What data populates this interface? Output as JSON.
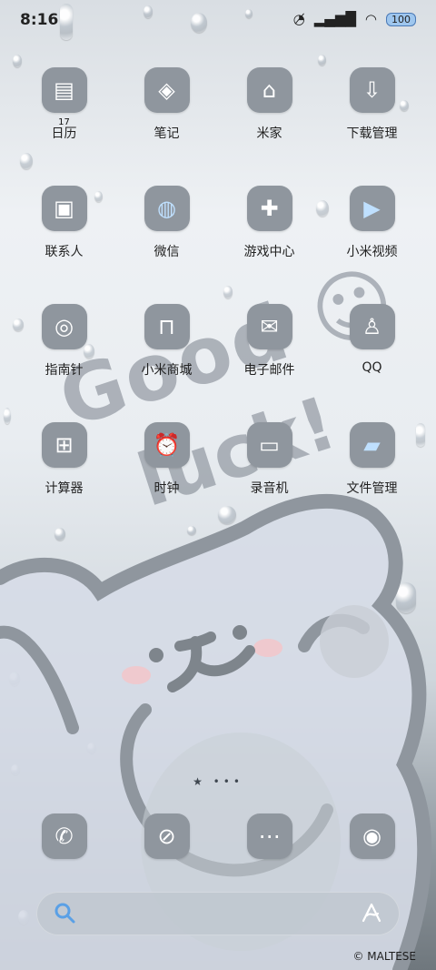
{
  "status_bar": {
    "time": "8:16",
    "battery": "100",
    "icons": [
      "do-not-disturb-icon",
      "signal-icon",
      "wifi-icon",
      "battery-icon"
    ]
  },
  "apps": [
    {
      "label": "日历",
      "icon": "calendar-icon",
      "badge": "17"
    },
    {
      "label": "笔记",
      "icon": "tag-icon"
    },
    {
      "label": "米家",
      "icon": "home-automation-icon"
    },
    {
      "label": "下载管理",
      "icon": "download-icon"
    },
    {
      "label": "联系人",
      "icon": "contacts-icon"
    },
    {
      "label": "微信",
      "icon": "wechat-icon"
    },
    {
      "label": "游戏中心",
      "icon": "gamepad-icon"
    },
    {
      "label": "小米视频",
      "icon": "play-icon"
    },
    {
      "label": "指南针",
      "icon": "compass-icon"
    },
    {
      "label": "小米商城",
      "icon": "cart-icon"
    },
    {
      "label": "电子邮件",
      "icon": "mail-icon"
    },
    {
      "label": "QQ",
      "icon": "qq-penguin-icon"
    },
    {
      "label": "计算器",
      "icon": "calculator-icon"
    },
    {
      "label": "时钟",
      "icon": "clock-icon"
    },
    {
      "label": "录音机",
      "icon": "recorder-icon"
    },
    {
      "label": "文件管理",
      "icon": "folder-icon"
    }
  ],
  "wallpaper_text": {
    "line1": "Good ☺",
    "line2": "luck!"
  },
  "page_indicator": "★ •••",
  "dock": [
    {
      "icon": "phone-icon"
    },
    {
      "icon": "browser-icon"
    },
    {
      "icon": "message-icon"
    },
    {
      "icon": "camera-icon"
    }
  ],
  "search_bar": {
    "icon": "search-icon",
    "assistant_icon": "assistant-icon"
  },
  "copyright": "© MALTESE"
}
